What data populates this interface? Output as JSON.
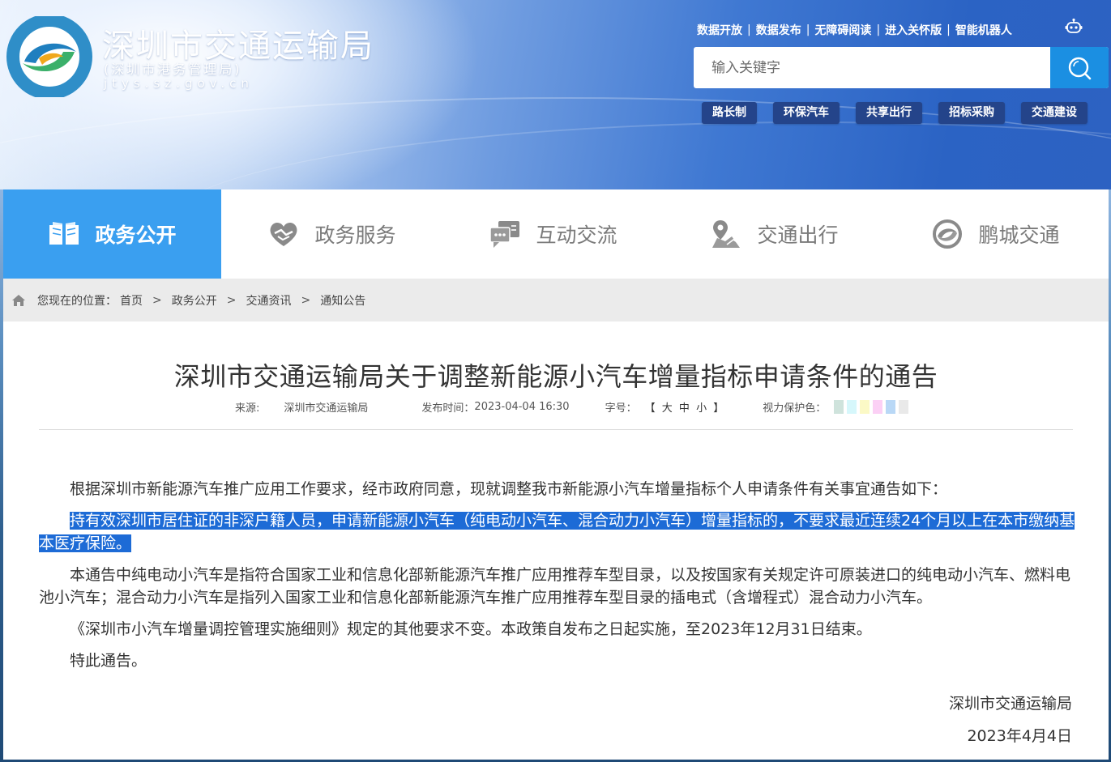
{
  "site": {
    "title": "深圳市交通运输局",
    "subtitle": "(深圳市港务管理局)",
    "domain": "jtys.sz.gov.cn",
    "logo_ring_text": "深圳市交通运输局"
  },
  "toplinks": [
    "数据开放",
    "数据发布",
    "无障碍阅读",
    "进入关怀版",
    "智能机器人"
  ],
  "search": {
    "placeholder": "输入关键字"
  },
  "quick_tags": [
    "路长制",
    "环保汽车",
    "共享出行",
    "招标采购",
    "交通建设"
  ],
  "nav": [
    {
      "label": "政务公开",
      "icon": "book-icon",
      "active": true
    },
    {
      "label": "政务服务",
      "icon": "heart-hands-icon",
      "active": false
    },
    {
      "label": "互动交流",
      "icon": "chat-icon",
      "active": false
    },
    {
      "label": "交通出行",
      "icon": "map-pin-icon",
      "active": false
    },
    {
      "label": "鹏城交通",
      "icon": "swirl-icon",
      "active": false
    }
  ],
  "breadcrumb": {
    "lead": "您现在的位置：",
    "items": [
      "首页",
      "政务公开",
      "交通资讯",
      "通知公告"
    ],
    "sep": ">"
  },
  "article": {
    "title": "深圳市交通运输局关于调整新能源小汽车增量指标申请条件的通告",
    "meta": {
      "source_label": "来源:",
      "source": "深圳市交通运输局",
      "date_label": "发布时间：",
      "date": "2023-04-04 16:30",
      "size_label": "字号：",
      "size_open": "【",
      "size_big": "大",
      "size_mid": "中",
      "size_small": "小",
      "size_close": "】",
      "eye_label": "视力保护色："
    },
    "paragraphs": [
      "根据深圳市新能源汽车推广应用工作要求，经市政府同意，现就调整我市新能源小汽车增量指标个人申请条件有关事宜通告如下：",
      "持有效深圳市居住证的非深户籍人员，申请新能源小汽车（纯电动小汽车、混合动力小汽车）增量指标的，不要求最近连续24个月以上在本市缴纳基本医疗保险。",
      "本通告中纯电动小汽车是指符合国家工业和信息化部新能源汽车推广应用推荐车型目录，以及按国家有关规定许可原装进口的纯电动小汽车、燃料电池小汽车；混合动力小汽车是指列入国家工业和信息化部新能源汽车推广应用推荐车型目录的插电式（含增程式）混合动力小汽车。",
      "《深圳市小汽车增量调控管理实施细则》规定的其他要求不变。本政策自发布之日起实施，至2023年12月31日结束。",
      "特此通告。"
    ],
    "signature": "深圳市交通运输局",
    "sign_date": "2023年4月4日"
  },
  "colors": {
    "accent": "#3a9ff0",
    "search_button": "#1b8fe2",
    "tag_bg": "#24448a",
    "selection": "#1d6bd6",
    "swatches": [
      "#cfe3dc",
      "#d6f7fb",
      "#fbf9c6",
      "#fbd0f5",
      "#b9d8f6",
      "#e9e9e9"
    ]
  }
}
